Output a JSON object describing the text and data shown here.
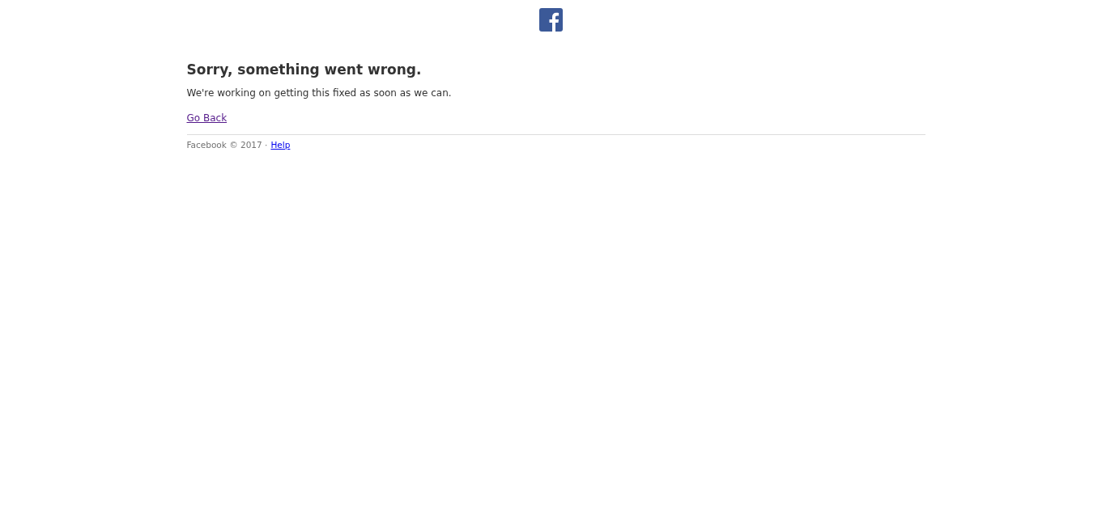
{
  "error": {
    "title": "Sorry, something went wrong.",
    "message": "We're working on getting this fixed as soon as we can.",
    "back_link": "Go Back"
  },
  "footer": {
    "text": "Facebook © 2017 ·",
    "help_link": "Help"
  }
}
